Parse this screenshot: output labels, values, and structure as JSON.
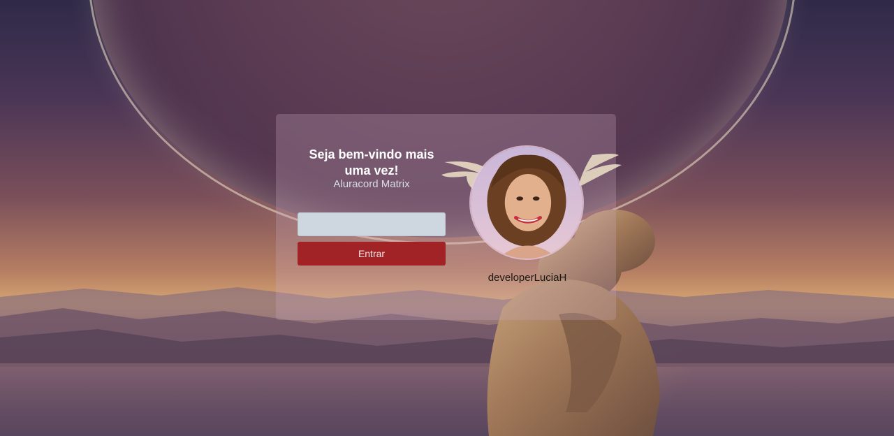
{
  "login": {
    "welcome_title": "Seja bem-vindo mais uma vez!",
    "app_name": "Aluracord Matrix",
    "username_input": {
      "value": "",
      "placeholder": ""
    },
    "submit_label": "Entrar",
    "profile": {
      "username": "developerLuciaH",
      "avatar_icon": "user-avatar-photo"
    }
  },
  "colors": {
    "button_bg": "#a12325",
    "input_bg": "#ced6df",
    "title_text": "#ffffff",
    "subtitle_text": "#d8dde4"
  }
}
